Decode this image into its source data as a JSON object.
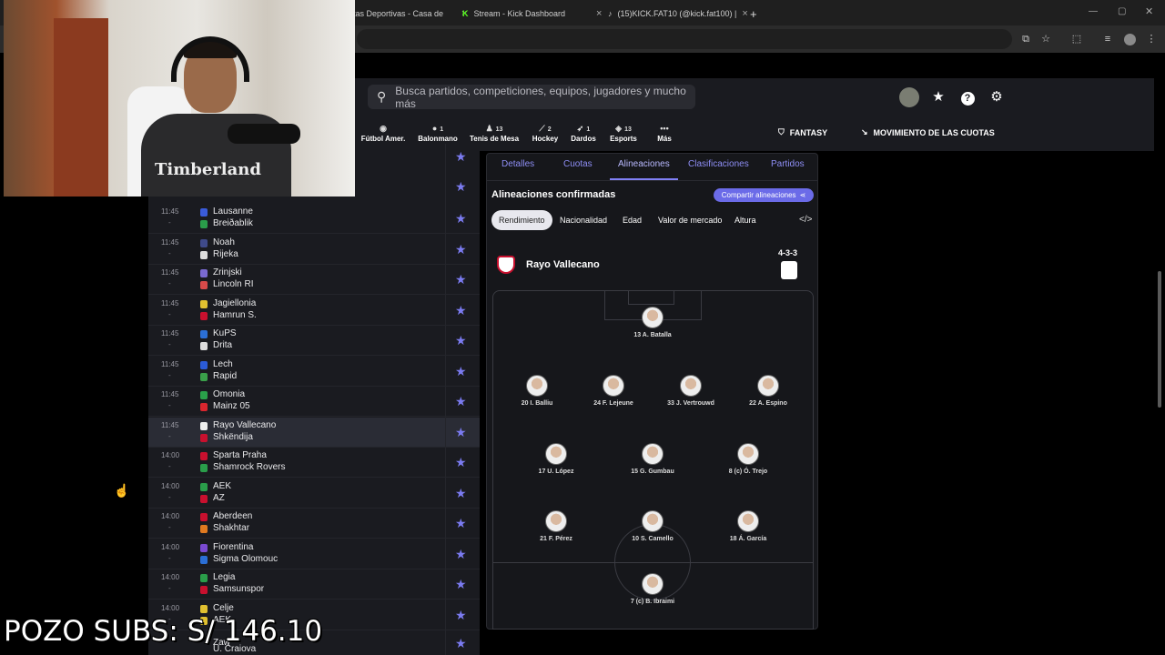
{
  "browser": {
    "tabs": [
      {
        "title": "tas Deportivas - Casa de",
        "close": "×"
      },
      {
        "title": "Stream - Kick Dashboard",
        "close": "×"
      },
      {
        "title": "(15)KICK.FAT10 (@kick.fat100) |",
        "close": "×"
      }
    ],
    "new_tab": "+"
  },
  "search": {
    "placeholder": "Busca partidos, competiciones, equipos, jugadores y mucho más"
  },
  "sports": [
    {
      "label": "Fútbol Amer.",
      "count": ""
    },
    {
      "label": "Balonmano",
      "count": "1"
    },
    {
      "label": "Tenis de Mesa",
      "count": "13"
    },
    {
      "label": "Hockey",
      "count": "2"
    },
    {
      "label": "Dardos",
      "count": "1"
    },
    {
      "label": "Esports",
      "count": "13"
    },
    {
      "label": "Más",
      "count": ""
    }
  ],
  "header_links": {
    "fantasy": "FANTASY",
    "odds": "MOVIMIENTO DE LAS CUOTAS"
  },
  "matches": [
    {
      "time": "11:45",
      "status": "-",
      "home": "Lausanne",
      "away": "Breiðablik",
      "home_color": "#3a5bd9",
      "away_color": "#2a9d4a"
    },
    {
      "time": "11:45",
      "status": "-",
      "home": "Noah",
      "away": "Rijeka",
      "home_color": "#3f4a8a",
      "away_color": "#dddddd"
    },
    {
      "time": "11:45",
      "status": "-",
      "home": "Zrinjski",
      "away": "Lincoln RI",
      "home_color": "#7a6ad1",
      "away_color": "#d84a4a"
    },
    {
      "time": "11:45",
      "status": "-",
      "home": "Jagiellonia",
      "away": "Hamrun S.",
      "home_color": "#e0c030",
      "away_color": "#c8102e"
    },
    {
      "time": "11:45",
      "status": "-",
      "home": "KuPS",
      "away": "Drita",
      "home_color": "#2b6fd6",
      "away_color": "#dddddd"
    },
    {
      "time": "11:45",
      "status": "-",
      "home": "Lech",
      "away": "Rapid",
      "home_color": "#2b5bd6",
      "away_color": "#3aa04a"
    },
    {
      "time": "11:45",
      "status": "-",
      "home": "Omonia",
      "away": "Mainz 05",
      "home_color": "#2aa04a",
      "away_color": "#d8262e"
    },
    {
      "time": "11:45",
      "status": "-",
      "home": "Rayo Vallecano",
      "away": "Shkëndija",
      "home_color": "#eeeeee",
      "away_color": "#c8102e"
    },
    {
      "time": "14:00",
      "status": "-",
      "home": "Sparta Praha",
      "away": "Shamrock Rovers",
      "home_color": "#c8102e",
      "away_color": "#2a9d4a"
    },
    {
      "time": "14:00",
      "status": "-",
      "home": "AEK",
      "away": "AZ",
      "home_color": "#2a9d4a",
      "away_color": "#c8102e"
    },
    {
      "time": "14:00",
      "status": "-",
      "home": "Aberdeen",
      "away": "Shakhtar",
      "home_color": "#c8102e",
      "away_color": "#e07a20"
    },
    {
      "time": "14:00",
      "status": "-",
      "home": "Fiorentina",
      "away": "Sigma Olomouc",
      "home_color": "#7a4ad1",
      "away_color": "#2b6fd6"
    },
    {
      "time": "14:00",
      "status": "-",
      "home": "Legia",
      "away": "Samsunspor",
      "home_color": "#2a9d4a",
      "away_color": "#c8102e"
    },
    {
      "time": "14:00",
      "status": "-",
      "home": "Celje",
      "away": "AEK",
      "home_color": "#e0c030",
      "away_color": "#e0c030"
    }
  ],
  "partial_rows": {
    "top_star": "★",
    "bottom_home": "Zaw",
    "bottom_away": "U. Craiova"
  },
  "detail": {
    "tabs": [
      "Detalles",
      "Cuotas",
      "Alineaciones",
      "Clasificaciones",
      "Partidos"
    ],
    "active_tab": "Alineaciones",
    "confirmed": "Alineaciones confirmadas",
    "share": "Compartir alineaciones",
    "filters": [
      "Rendimiento",
      "Nacionalidad",
      "Edad",
      "Valor de mercado",
      "Altura"
    ],
    "team": "Rayo Vallecano",
    "formation": "4-3-3",
    "players": [
      "13 A. Batalla",
      "20 I. Balliu",
      "24 F. Lejeune",
      "33 J. Vertrouwd",
      "22 A. Espino",
      "17 U. López",
      "15 G. Gumbau",
      "8 (c) Ó. Trejo",
      "21 F. Pérez",
      "10 S. Camello",
      "18 Á. García",
      "7 (c) B. Ibraimi"
    ]
  },
  "webcam": {
    "shirt_text": "Timberland"
  },
  "overlay": "POZO SUBS: S/ 146.10",
  "colors": {
    "accent": "#7b7bf0",
    "panel": "#1a1b20",
    "share_button": "#6b6be8"
  }
}
